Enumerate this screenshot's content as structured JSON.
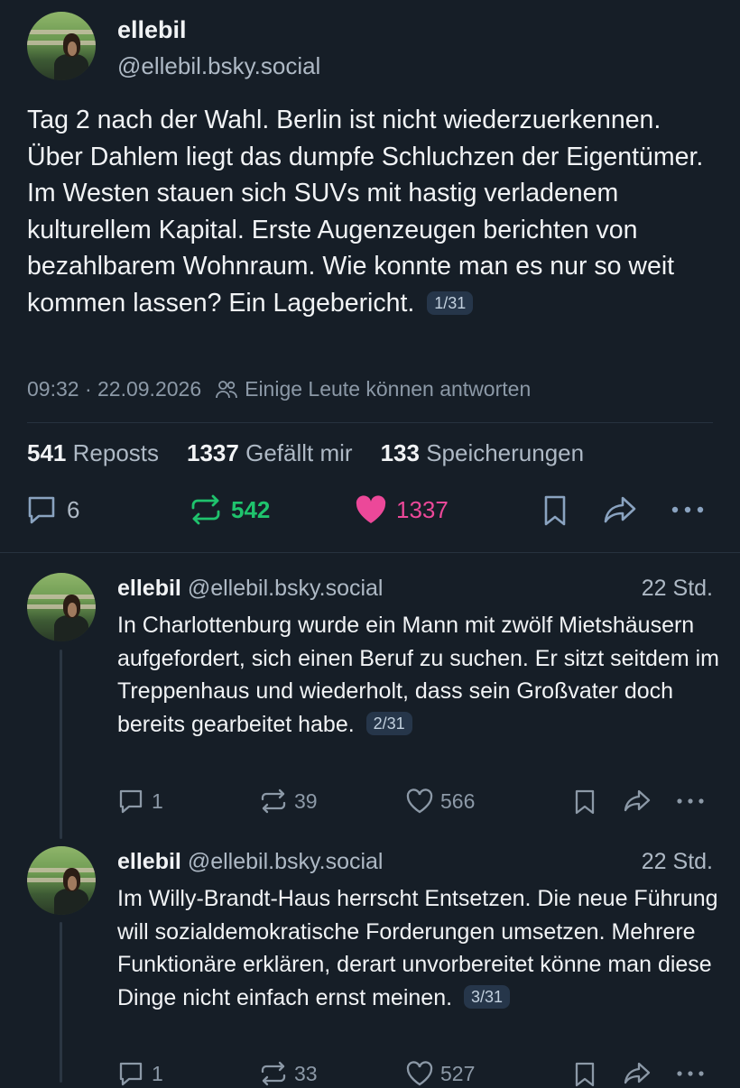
{
  "post": {
    "author_name": "ellebil",
    "author_handle": "@ellebil.bsky.social",
    "text": "Tag 2 nach der Wahl. Berlin ist nicht wiederzuerkennen. Über Dahlem liegt das dumpfe Schluchzen der Eigentümer. Im Westen stauen sich SUVs mit hastig verladenem kulturellem Kapital. Erste Augenzeugen berichten von bezahlbarem Wohnraum. Wie konnte man es nur so weit kommen lassen? Ein Lagebericht.",
    "thread_badge": "1/31",
    "timestamp": "09:32 · 22.09.2026",
    "reply_setting": "Einige Leute können antworten",
    "stats": {
      "reposts_count": "541",
      "reposts_label": "Reposts",
      "likes_count": "1337",
      "likes_label": "Gefällt mir",
      "saves_count": "133",
      "saves_label": "Speicherungen"
    },
    "actions": {
      "replies": "6",
      "reposts": "542",
      "likes": "1337"
    }
  },
  "replies": [
    {
      "author_name": "ellebil",
      "author_handle": "@ellebil.bsky.social",
      "time": "22 Std.",
      "text": "In Charlottenburg wurde ein Mann mit zwölf Mietshäusern aufgefordert, sich einen Beruf zu suchen. Er sitzt seitdem im Treppenhaus und wiederholt, dass sein Großvater doch bereits gearbeitet habe.",
      "badge": "2/31",
      "replies": "1",
      "reposts": "39",
      "likes": "566"
    },
    {
      "author_name": "ellebil",
      "author_handle": "@ellebil.bsky.social",
      "time": "22 Std.",
      "text": "Im Willy-Brandt-Haus herrscht Entsetzen. Die neue Führung will sozialdemokratische Forderungen umsetzen. Mehrere Funktionäre erklären, derart unvorbereitet könne man diese Dinge nicht einfach ernst meinen.",
      "badge": "3/31",
      "replies": "1",
      "reposts": "33",
      "likes": "527"
    }
  ],
  "colors": {
    "background": "#161e27",
    "repost_active": "#1fc36d",
    "like_active": "#ec4899",
    "muted": "#8c99a7"
  },
  "icons": [
    "reply-icon",
    "repost-icon",
    "heart-icon",
    "bookmark-icon",
    "share-icon",
    "more-icon",
    "people-icon"
  ]
}
